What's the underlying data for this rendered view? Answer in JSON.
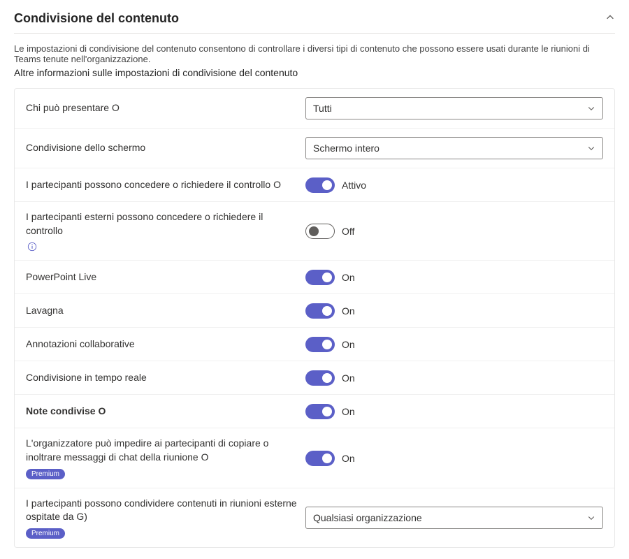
{
  "section": {
    "title": "Condivisione del contenuto",
    "description": "Le impostazioni di condivisione del contenuto consentono di controllare i diversi tipi di contenuto che possono essere usati durante le riunioni di Teams tenute nell'organizzazione.",
    "learn_more": "Altre informazioni sulle impostazioni di condivisione del contenuto"
  },
  "rows": {
    "who_present": {
      "label": "Chi può presentare O",
      "value": "Tutti"
    },
    "screen_sharing": {
      "label": "Condivisione dello schermo",
      "value": "Schermo intero"
    },
    "give_request_control": {
      "label": "I partecipanti possono concedere o richiedere il controllo O",
      "state": "Attivo"
    },
    "external_give_request": {
      "label": "I partecipanti esterni possono concedere o richiedere il controllo",
      "state": "Off"
    },
    "ppt_live": {
      "label": "PowerPoint Live",
      "state": "On"
    },
    "whiteboard": {
      "label": "Lavagna",
      "state": "On"
    },
    "collab_annotations": {
      "label": "Annotazioni collaborative",
      "state": "On"
    },
    "live_share": {
      "label": "Condivisione in tempo reale",
      "state": "On"
    },
    "shared_notes": {
      "label": "Note condivise O",
      "state": "On"
    },
    "prevent_copy": {
      "label": "L'organizzatore può impedire ai partecipanti di copiare o inoltrare messaggi di chat della riunione O",
      "state": "On",
      "badge": "Premium"
    },
    "share_external": {
      "label": "I partecipanti possono condividere contenuti in riunioni esterne ospitate da G)",
      "value": "Qualsiasi organizzazione",
      "badge": "Premium"
    }
  }
}
